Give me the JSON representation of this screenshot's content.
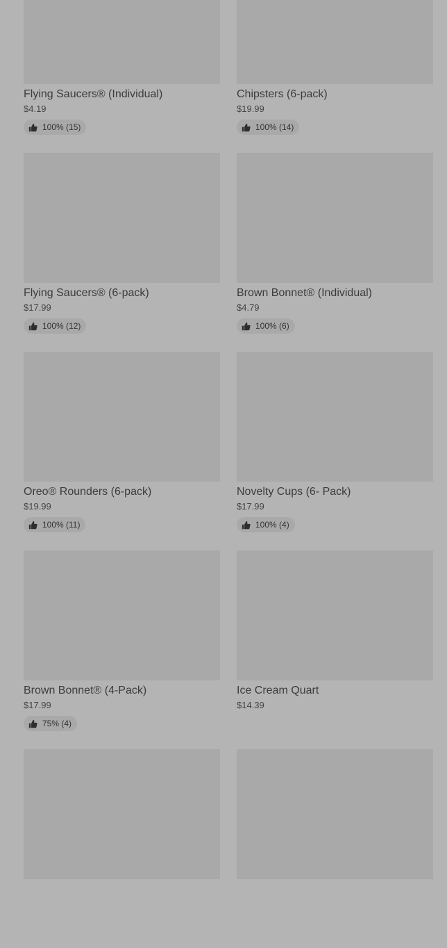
{
  "products": [
    {
      "name": "Flying Saucers® (Individual)",
      "price": "$4.19",
      "rating": "100% (15)"
    },
    {
      "name": "Chipsters (6-pack)",
      "price": "$19.99",
      "rating": "100% (14)"
    },
    {
      "name": "Flying Saucers® (6-pack)",
      "price": "$17.99",
      "rating": "100% (12)"
    },
    {
      "name": "Brown Bonnet® (Individual)",
      "price": "$4.79",
      "rating": "100% (6)"
    },
    {
      "name": "Oreo® Rounders (6-pack)",
      "price": "$19.99",
      "rating": "100% (11)"
    },
    {
      "name": "Novelty Cups (6- Pack)",
      "price": "$17.99",
      "rating": "100% (4)"
    },
    {
      "name": "Brown Bonnet® (4-Pack)",
      "price": "$17.99",
      "rating": "75% (4)"
    },
    {
      "name": "Ice Cream Quart",
      "price": "$14.39",
      "rating": ""
    },
    {
      "name": "",
      "price": "",
      "rating": ""
    },
    {
      "name": "",
      "price": "",
      "rating": ""
    }
  ],
  "icons": {
    "rating": "thumbs-up-icon"
  },
  "colors": {
    "background": "#b4b4b4",
    "placeholder": "#a9a9a9",
    "text": "#3c3c3c"
  }
}
